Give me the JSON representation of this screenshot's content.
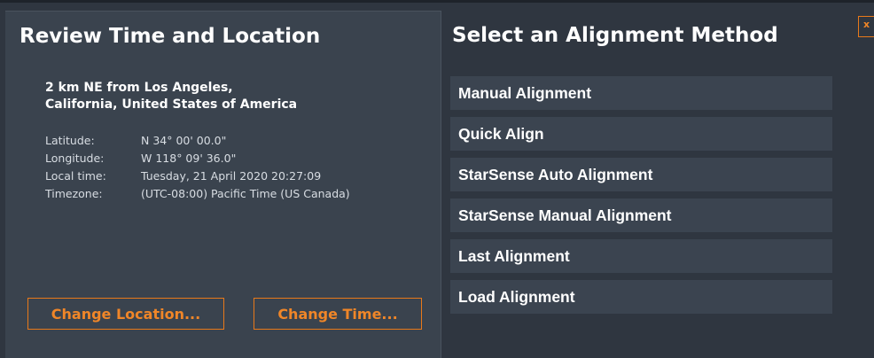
{
  "review": {
    "title": "Review Time and Location",
    "location_line1": "2 km NE from Los Angeles,",
    "location_line2": "California, United States of America",
    "rows": [
      {
        "label": "Latitude:",
        "value": "N 34° 00' 00.0\""
      },
      {
        "label": "Longitude:",
        "value": "W 118° 09' 36.0\""
      },
      {
        "label": "Local time:",
        "value": "Tuesday, 21 April 2020 20:27:09"
      },
      {
        "label": "Timezone:",
        "value": "(UTC-08:00) Pacific Time (US  Canada)"
      }
    ],
    "change_location_label": "Change Location...",
    "change_time_label": "Change Time..."
  },
  "alignment": {
    "title": "Select an Alignment Method",
    "methods": [
      "Manual Alignment",
      "Quick Align",
      "StarSense Auto Alignment",
      "StarSense Manual Alignment",
      "Last Alignment",
      "Load Alignment"
    ]
  },
  "close_label": "x",
  "colors": {
    "background": "#2f3640",
    "panel": "#3a434e",
    "accent": "#f08628",
    "text": "#ffffff"
  }
}
